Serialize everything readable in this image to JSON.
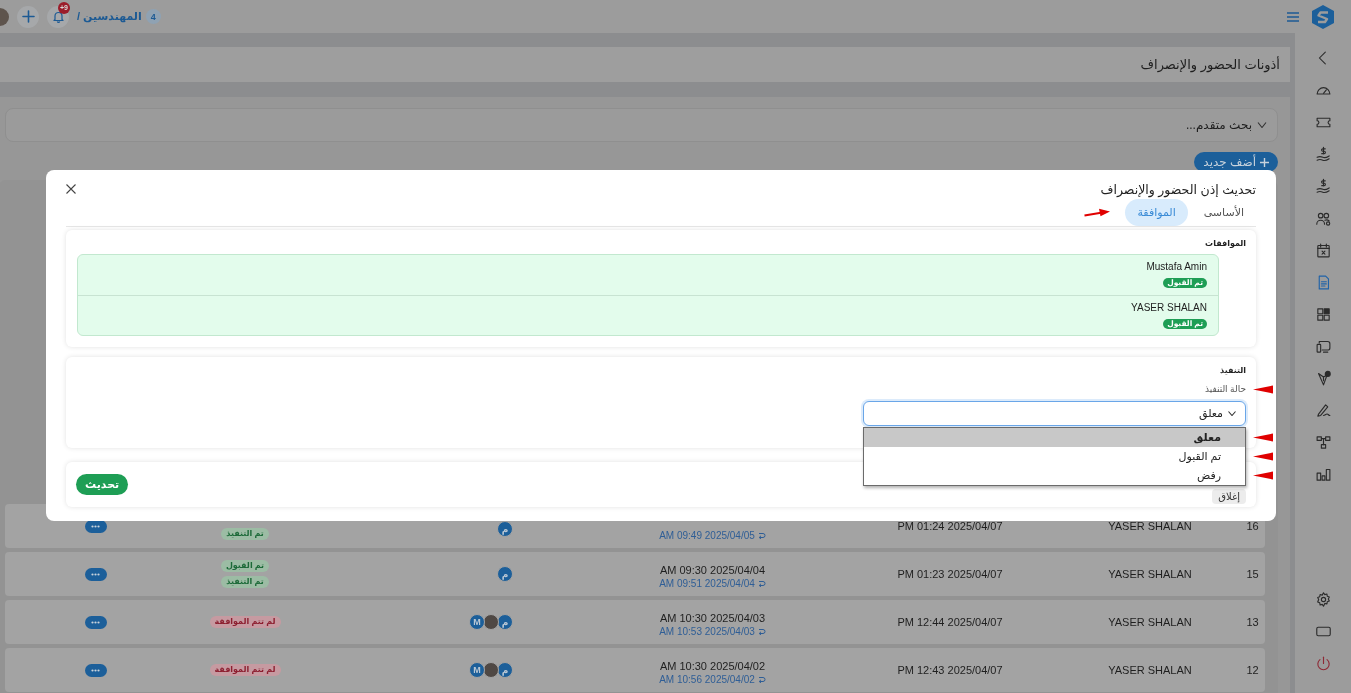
{
  "top_bar": {
    "notification_badge": "+9",
    "breadcrumb": "المهندسين /",
    "count_badge": "4"
  },
  "sidebar": {
    "items": [
      {
        "kind": "gauge",
        "selected": false
      },
      {
        "kind": "ticket",
        "selected": false
      },
      {
        "kind": "payment",
        "selected": false
      },
      {
        "kind": "payment",
        "selected": false
      },
      {
        "kind": "team",
        "selected": false
      },
      {
        "kind": "calendar",
        "selected": false
      },
      {
        "kind": "document",
        "selected": true
      },
      {
        "kind": "widgets",
        "selected": false
      },
      {
        "kind": "devices",
        "selected": false
      },
      {
        "kind": "approval",
        "selected": false
      },
      {
        "kind": "signature",
        "selected": false
      },
      {
        "kind": "workflow",
        "selected": false
      },
      {
        "kind": "chart",
        "selected": false
      }
    ],
    "footer_items": [
      {
        "kind": "settings"
      },
      {
        "kind": "screen"
      },
      {
        "kind": "power"
      }
    ]
  },
  "page": {
    "title": "أذونات الحضور والإنصراف",
    "search": {
      "label": "بحث متقدم...",
      "expanded": false
    },
    "add_button": "أضف جديد"
  },
  "table": {
    "rows": [
      {
        "number": "16",
        "name": "YASER SHALAN",
        "created": "PM 01:24 2025/04/07",
        "end_time": "AM 09:49 2025/04/05",
        "approvers": [
          {
            "kind": "initial",
            "text": "م"
          }
        ],
        "statuses": [
          {
            "label": "تم التنفيذ",
            "kind": "success"
          }
        ]
      },
      {
        "number": "15",
        "name": "YASER SHALAN",
        "created": "PM 01:23 2025/04/07",
        "start_time": "AM 09:30 2025/04/04",
        "end_time": "AM 09:51 2025/04/04",
        "approvers": [
          {
            "kind": "initial",
            "text": "م"
          }
        ],
        "statuses": [
          {
            "label": "تم القبول",
            "kind": "success"
          },
          {
            "label": "تم التنفيذ",
            "kind": "success"
          }
        ]
      },
      {
        "number": "13",
        "name": "YASER SHALAN",
        "created": "PM 12:44 2025/04/07",
        "start_time": "AM 10:30 2025/04/03",
        "end_time": "AM 10:53 2025/04/03",
        "approvers": [
          {
            "kind": "initial",
            "text": "م"
          },
          {
            "kind": "photo"
          },
          {
            "kind": "initial",
            "text": "M"
          }
        ],
        "statuses": [
          {
            "label": "لم تتم الموافقة",
            "kind": "danger"
          }
        ]
      },
      {
        "number": "12",
        "name": "YASER SHALAN",
        "created": "PM 12:43 2025/04/07",
        "start_time": "AM 10:30 2025/04/02",
        "end_time": "AM 10:56 2025/04/02",
        "approvers": [
          {
            "kind": "initial",
            "text": "م"
          },
          {
            "kind": "photo"
          },
          {
            "kind": "initial",
            "text": "M"
          }
        ],
        "statuses": [
          {
            "label": "لم تتم الموافقة",
            "kind": "danger"
          }
        ]
      }
    ]
  },
  "modal": {
    "title": "تحديث إذن الحضور والإنصراف",
    "tabs": [
      {
        "label": "الأساسى",
        "selected": false
      },
      {
        "label": "الموافقة",
        "selected": true
      }
    ],
    "approvals": {
      "heading": "الموافقات",
      "items": [
        {
          "name": "Mustafa Amin",
          "status": "تم القبول"
        },
        {
          "name": "YASER SHALAN",
          "status": "تم القبول"
        }
      ]
    },
    "execution": {
      "heading": "التنفيذ",
      "field": {
        "label": "حالة التنفيذ",
        "value": "معلق",
        "expanded": true,
        "options": [
          {
            "label": "معلق",
            "selected": true
          },
          {
            "label": "تم القبول",
            "selected": false
          },
          {
            "label": "رفض",
            "selected": false
          }
        ]
      }
    },
    "buttons": [
      {
        "label": "إغلاق",
        "kind": "secondary"
      },
      {
        "label": "تحديث",
        "kind": "primary"
      }
    ]
  }
}
